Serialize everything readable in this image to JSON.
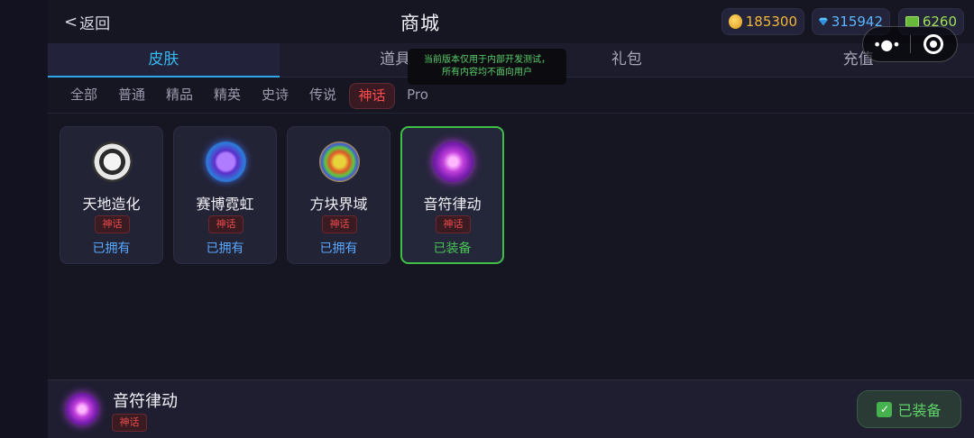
{
  "header": {
    "back_label": "返回",
    "title": "商城",
    "currencies": {
      "coins": "185300",
      "gems": "315942",
      "cash": "6260"
    }
  },
  "tabs": [
    {
      "label": "皮肤",
      "active": true
    },
    {
      "label": "道具",
      "active": false
    },
    {
      "label": "礼包",
      "active": false
    },
    {
      "label": "充值",
      "active": false
    }
  ],
  "tooltip": {
    "line1": "当前版本仅用于内部开发测试，",
    "line2": "所有内容均不面向用户"
  },
  "filters": [
    {
      "label": "全部",
      "active": false
    },
    {
      "label": "普通",
      "active": false
    },
    {
      "label": "精品",
      "active": false
    },
    {
      "label": "精英",
      "active": false
    },
    {
      "label": "史诗",
      "active": false
    },
    {
      "label": "传说",
      "active": false
    },
    {
      "label": "神话",
      "active": true
    },
    {
      "label": "Pro",
      "active": false
    }
  ],
  "skins": [
    {
      "name": "天地造化",
      "rarity": "神话",
      "status": "已拥有",
      "icon": "taiji-icon"
    },
    {
      "name": "赛博霓虹",
      "rarity": "神话",
      "status": "已拥有",
      "icon": "cyber-neon-icon"
    },
    {
      "name": "方块界域",
      "rarity": "神话",
      "status": "已拥有",
      "icon": "block-realm-icon"
    },
    {
      "name": "音符律动",
      "rarity": "神话",
      "status": "已装备",
      "icon": "music-note-icon",
      "selected": true
    }
  ],
  "selected": {
    "name": "音符律动",
    "rarity": "神话",
    "button_label": "已装备"
  },
  "colors": {
    "accent": "#37b9f0",
    "mythic": "#e84a4a",
    "equipped": "#48c254",
    "owned": "#58a7ff"
  }
}
